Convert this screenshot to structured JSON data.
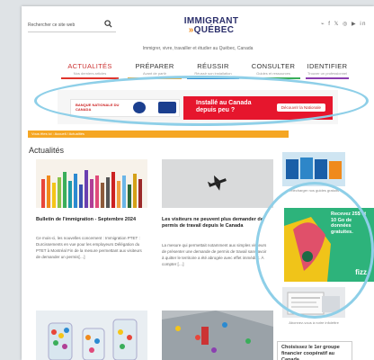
{
  "header": {
    "search_placeholder": "Rechercher ce site web",
    "logo_line1": "IMMIGRANT",
    "logo_line2": "QUÉBEC",
    "logo_arrows": "»",
    "social_icons": [
      "rss-icon",
      "facebook-icon",
      "x-icon",
      "instagram-icon",
      "youtube-icon",
      "linkedin-icon"
    ],
    "tagline": "Immigrer, vivre, travailler et étudier au Québec, Canada"
  },
  "nav": [
    {
      "label": "ACTUALITÉS",
      "sub": "Nos derniers articles",
      "color": "#e0342c"
    },
    {
      "label": "PRÉPARER",
      "sub": "Avant de partir",
      "color": "#f5a623"
    },
    {
      "label": "RÉUSSIR",
      "sub": "Réussir son installation",
      "color": "#2b8ad1"
    },
    {
      "label": "CONSULTER",
      "sub": "Guides et ressources",
      "color": "#3aae5a"
    },
    {
      "label": "IDENTIFIER",
      "sub": "Trouver un professionnel",
      "color": "#8b3fb0"
    }
  ],
  "banner": {
    "bank": "BANQUE NATIONALE DU CANADA",
    "message": "Installé au Canada depuis peu ?",
    "cta": "Découvrir la Nationale"
  },
  "breadcrumb": "Vous êtes ici : Accueil / Actualités",
  "section_title": "Actualités",
  "articles": [
    {
      "title": "Bulletin de l'immigration - Septembre 2024",
      "excerpt": "Ce mois-ci, les nouvelles concernent : Immigration PTET : Durcissements en vue pour les employeurs Délégation du PTET à Montréal Fin de la mesure permettant aux visiteurs de demander un permis[…]"
    },
    {
      "title": "Les visiteurs ne peuvent plus demander de permis de travail depuis le Canada",
      "excerpt": "La mesure qui permettait notamment aux simples visiteurs de présenter une demande de permis de travail sans avoir à quitter le territoire a été abrogée avec effet immédiat. À compter […]"
    }
  ],
  "sidebar": {
    "guides_caption": "Télécharger nos guides gratuits",
    "ad_text": "Recevez 25$ et 10 Go de données gratuites.",
    "ad_brand": "fizz",
    "newsletter_caption": "Abonnez-vous à notre infolettre",
    "coop_text": "Choisissez le 1er groupe financier coopératif au Canada"
  },
  "colors": {
    "accent_orange": "#f5a623",
    "nav_red": "#e0342c",
    "ad_green": "#2db37b",
    "bank_red": "#e6162d",
    "highlight_ring": "#8ecfe8"
  }
}
